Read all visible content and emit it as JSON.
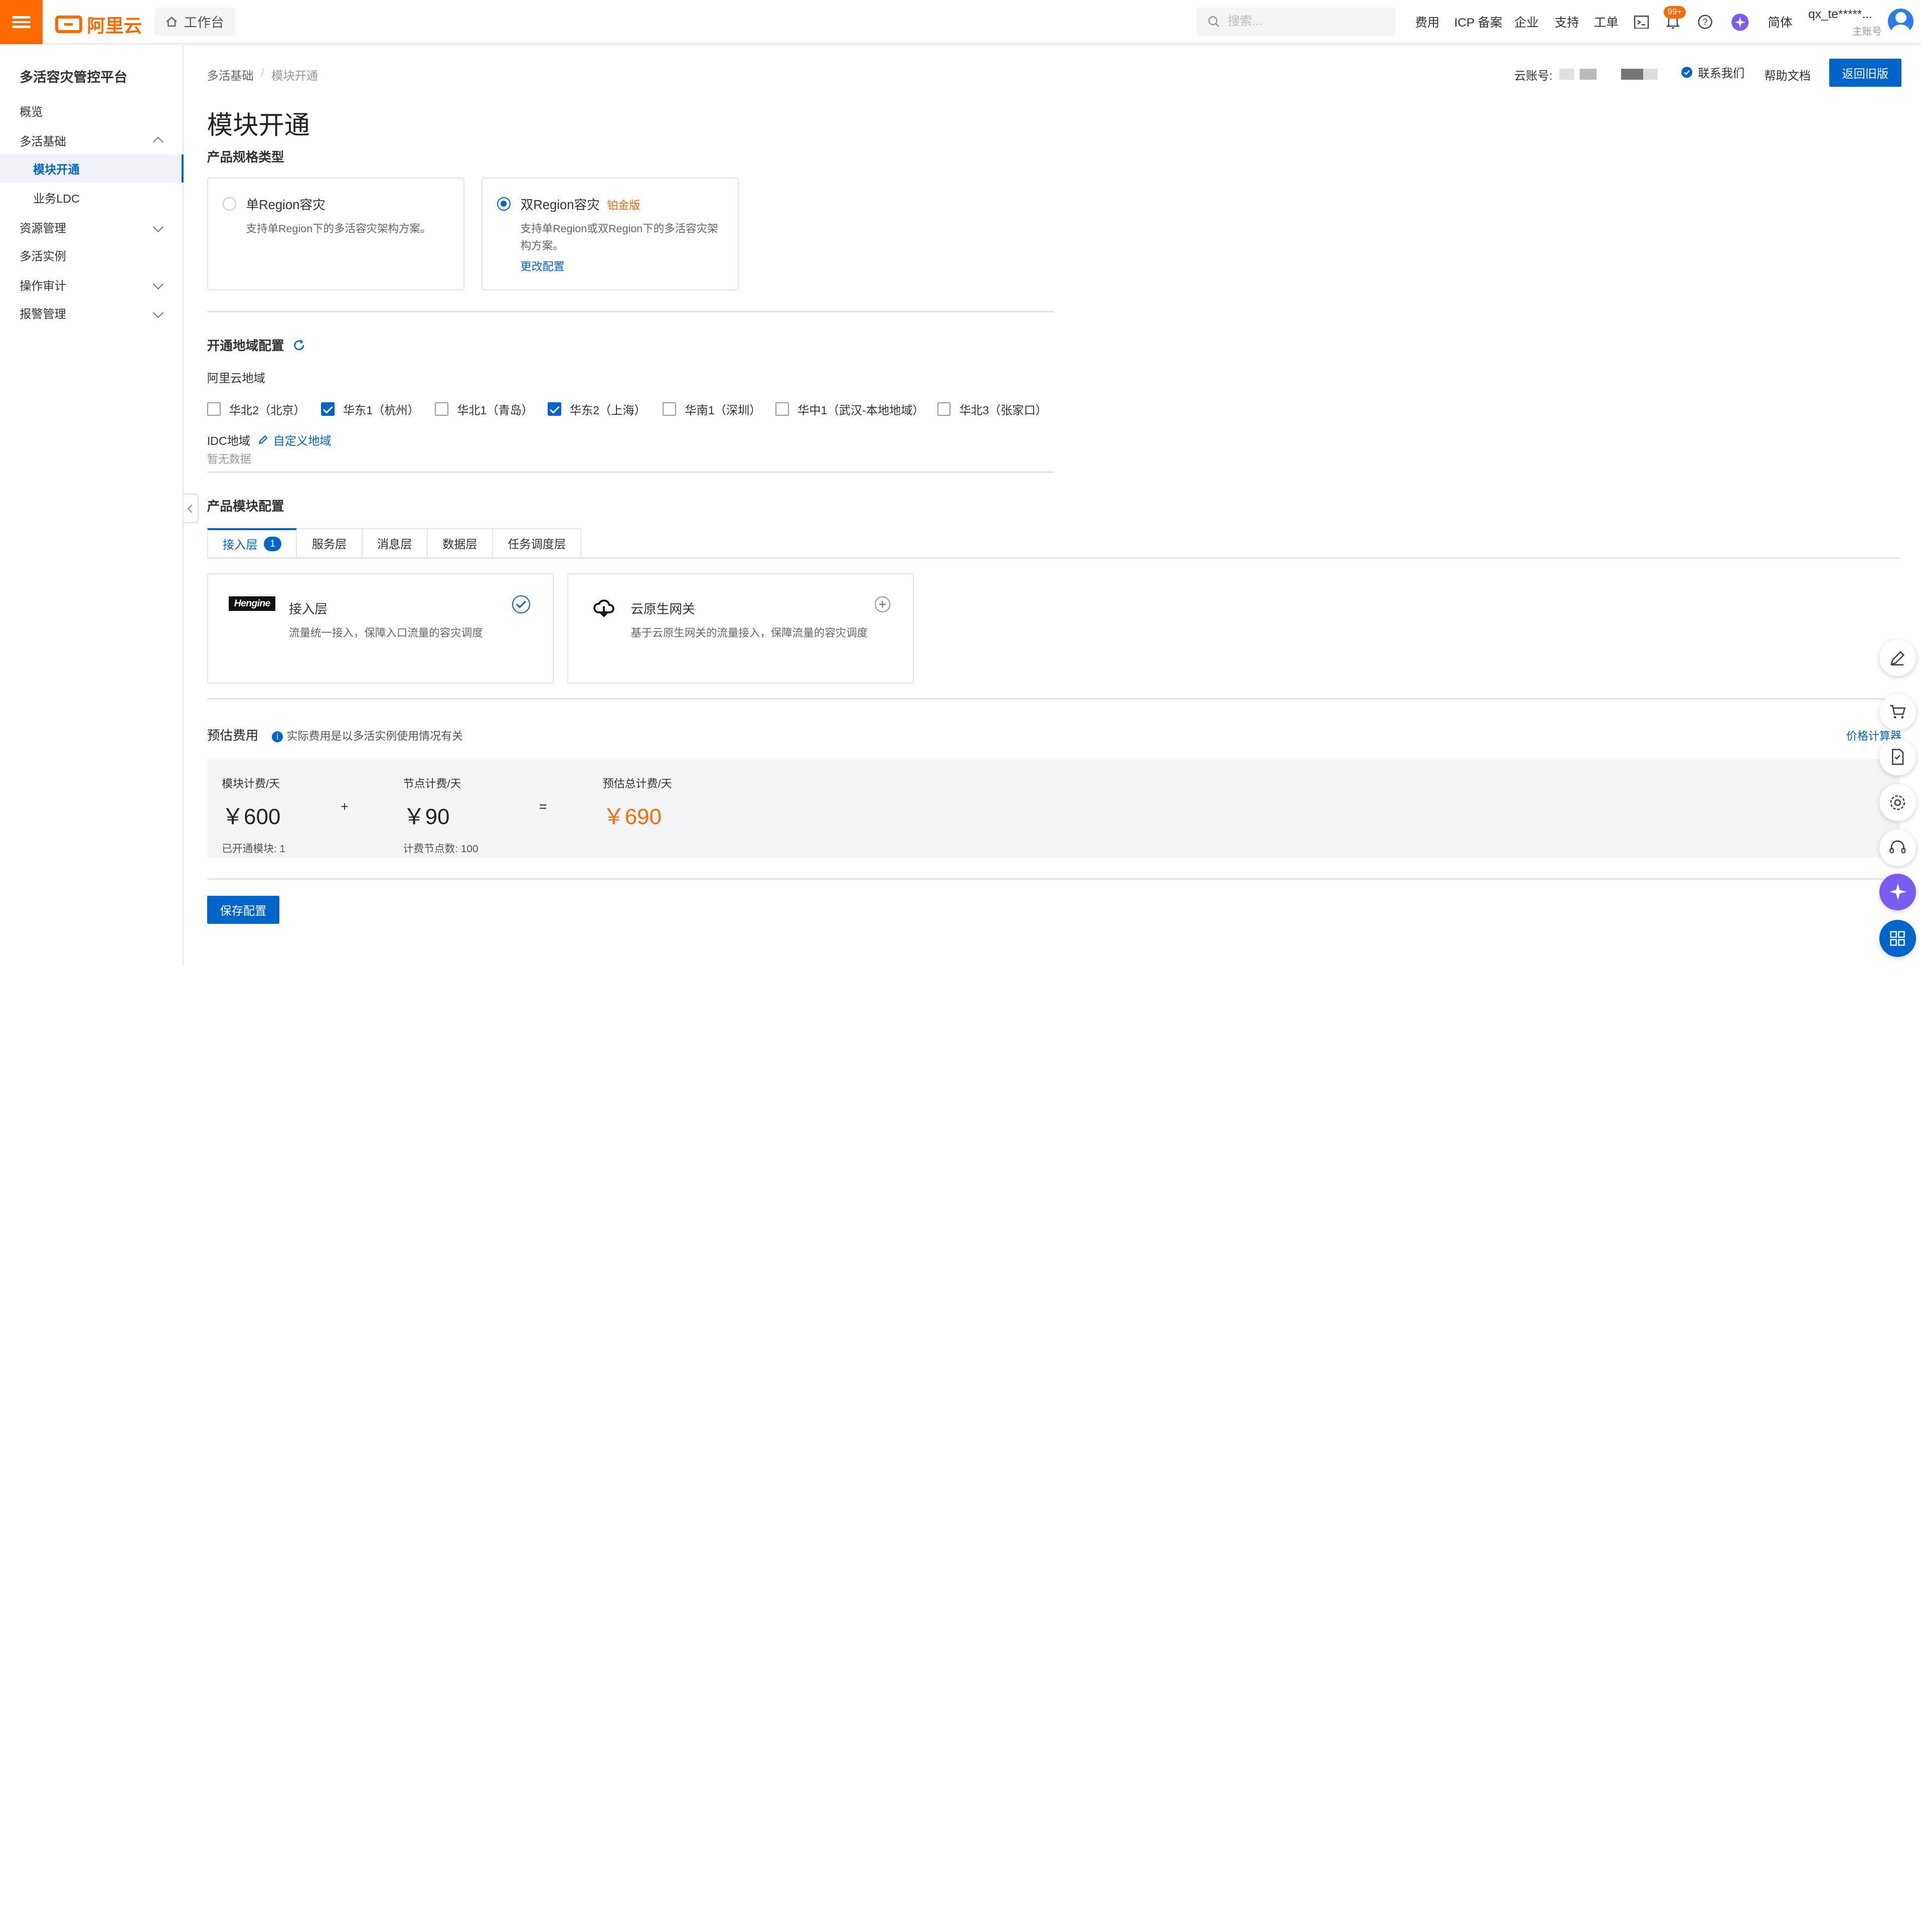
{
  "header": {
    "brand": "阿里云",
    "workbench": "工作台",
    "search_placeholder": "搜索...",
    "nav": [
      "费用",
      "ICP 备案",
      "企业",
      "支持",
      "工单"
    ],
    "notification_badge": "99+",
    "language": "简体",
    "account_name": "qx_te*****...",
    "account_type": "主账号"
  },
  "sidebar": {
    "title": "多活容灾管控平台",
    "items": [
      {
        "label": "概览"
      },
      {
        "label": "多活基础"
      },
      {
        "label": "模块开通"
      },
      {
        "label": "业务LDC"
      },
      {
        "label": "资源管理"
      },
      {
        "label": "多活实例"
      },
      {
        "label": "操作审计"
      },
      {
        "label": "报警管理"
      }
    ]
  },
  "breadcrumb": {
    "parent": "多活基础",
    "sep": "/",
    "current": "模块开通"
  },
  "top_right": {
    "cloud_account_label": "云账号:",
    "contact": "联系我们",
    "help": "帮助文档",
    "back_button": "返回旧版"
  },
  "page": {
    "title": "模块开通",
    "spec_section": "产品规格类型",
    "spec_cards": [
      {
        "title": "单Region容灾",
        "desc": "支持单Region下的多活容灾架构方案。"
      },
      {
        "title": "双Region容灾",
        "tag": "铂金版",
        "desc": "支持单Region或双Region下的多活容灾架构方案。",
        "link": "更改配置"
      }
    ],
    "region_section": "开通地域配置",
    "aliyun_regions_label": "阿里云地域",
    "regions": [
      {
        "label": "华北2（北京）",
        "checked": false
      },
      {
        "label": "华东1（杭州）",
        "checked": true
      },
      {
        "label": "华北1（青岛）",
        "checked": false
      },
      {
        "label": "华东2（上海）",
        "checked": true
      },
      {
        "label": "华南1（深圳）",
        "checked": false
      },
      {
        "label": "华中1（武汉-本地地域）",
        "checked": false
      },
      {
        "label": "华北3（张家口）",
        "checked": false
      }
    ],
    "idc_label": "IDC地域",
    "custom_region": "自定义地域",
    "no_data": "暂无数据",
    "module_section": "产品模块配置",
    "tabs": [
      {
        "label": "接入层",
        "count": "1"
      },
      {
        "label": "服务层"
      },
      {
        "label": "消息层"
      },
      {
        "label": "数据层"
      },
      {
        "label": "任务调度层"
      }
    ],
    "modules": [
      {
        "logo_text": "Hengine",
        "title": "接入层",
        "desc": "流量统一接入，保障入口流量的容灾调度",
        "selected": true
      },
      {
        "title": "云原生网关",
        "desc": "基于云原生网关的流量接入，保障流量的容灾调度",
        "selected": false
      }
    ],
    "fee_section": "预估费用",
    "fee_note": "实际费用是以多活实例使用情况有关",
    "price_calculator": "价格计算器",
    "fees": {
      "module_label": "模块计费/天",
      "module_value": "￥600",
      "module_sub": "已开通模块: 1",
      "plus": "+",
      "node_label": "节点计费/天",
      "node_value": "￥90",
      "node_sub": "计费节点数: 100",
      "equals": "=",
      "total_label": "预估总计费/天",
      "total_value": "￥690"
    },
    "save_button": "保存配置"
  },
  "colors": {
    "accent": "#0064c8",
    "brand": "#ff6a00"
  }
}
